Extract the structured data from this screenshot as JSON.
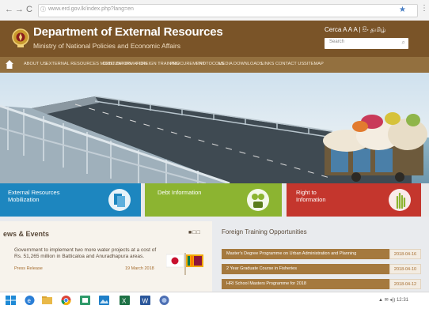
{
  "browser": {
    "url": "www.erd.gov.lk/index.php?lang=en",
    "back_glyph": "←",
    "forward_glyph": "→",
    "reload_glyph": "C",
    "info_glyph": "ⓘ",
    "star_glyph": "★",
    "menu_glyph": "⋮"
  },
  "header": {
    "title": "Department of External Resources",
    "subtitle": "Ministry of National Policies and Economic Affairs",
    "tools_text": "Cerca   A A A  |  සිං  தமிழ்",
    "search_placeholder": "Search"
  },
  "nav": {
    "home_label": "home",
    "items": [
      "ABOUT US",
      "EXTERNAL RESOURCES MOBILIZATION",
      "DEBT INFORMATION",
      "FOREIGN TRAINING",
      "PROCUREMENT",
      "PROTOCOLS",
      "MEDIA",
      "DOWNLOADS",
      "LINKS",
      "CONTACT US",
      "SITEMAP"
    ]
  },
  "tiles": [
    {
      "label": "External Resources Mobilization",
      "color": "#1d86bf",
      "icon": "documents-icon"
    },
    {
      "label": "Debt Information",
      "color": "#8cb431",
      "icon": "coin-bag-icon"
    },
    {
      "label": "Right to Information",
      "color": "#c4362d",
      "icon": "raised-hand-icon"
    }
  ],
  "news": {
    "heading": "ews & Events",
    "headline": "Government to implement two more water projects at a cost of Rs. 51,265 million in Batticaloa and Anuradhapura areas.",
    "source": "Press Release",
    "date": "19 March 2018",
    "pager": "■□□"
  },
  "training": {
    "heading": "Foreign Training Opportunities",
    "rows": [
      {
        "title": "Master's Degree Programme on Urban Administration and Planning",
        "date": "2018-04-16"
      },
      {
        "title": "2 Year Graduate Course in Fisheries",
        "date": "2018-04-10"
      },
      {
        "title": "HRI School Masters Programme for 2018",
        "date": "2018-04-12"
      }
    ]
  },
  "taskbar": {
    "tray_text": "▲ ✉ ◂)) 12:31",
    "icons": [
      "start-icon",
      "edge-icon",
      "folder-icon",
      "chrome-icon",
      "office-icon",
      "photos-icon",
      "excel-icon",
      "word-icon",
      "other-app-icon"
    ]
  },
  "colors": {
    "header_brown": "#7a5428",
    "nav_brown": "#93703f",
    "tile_blue": "#1d86bf",
    "tile_green": "#8cb431",
    "tile_red": "#c4362d",
    "training_row": "#a5793e"
  }
}
